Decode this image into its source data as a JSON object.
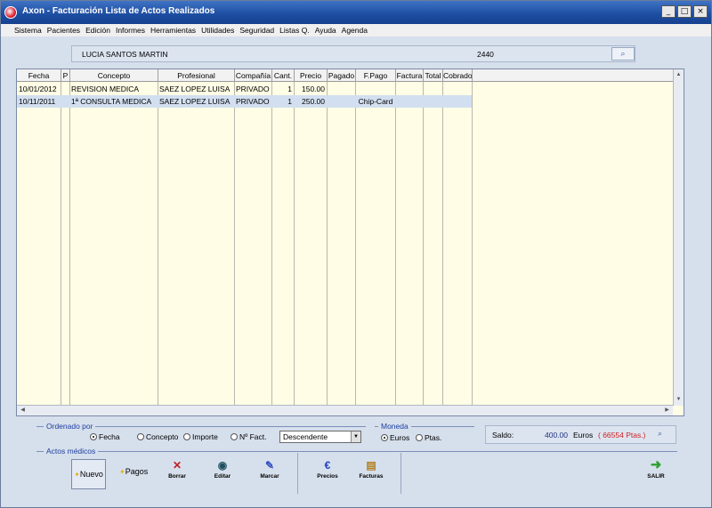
{
  "window": {
    "title": "Axon - Facturación Lista de Actos Realizados"
  },
  "window_buttons": {
    "minimize": "_",
    "maximize": "□",
    "close": "×"
  },
  "menu": [
    "Sistema",
    "Pacientes",
    "Edición",
    "Informes",
    "Herramientas",
    "Utilidades",
    "Seguridad",
    "Listas Q.",
    "Ayuda",
    "Agenda"
  ],
  "patient": {
    "name": "LUCIA SANTOS MARTIN",
    "id": "2440",
    "search_icon": "magnifier-icon"
  },
  "grid": {
    "columns": [
      "Fecha",
      "P",
      "Concepto",
      "Profesional",
      "Compañía",
      "Cant.",
      "Precio",
      "Pagado",
      "F.Pago",
      "Factura",
      "Total",
      "Cobrado"
    ],
    "rows": [
      {
        "fecha": "10/01/2012",
        "p": "",
        "concepto": "REVISION MEDICA",
        "profesional": "SAEZ LOPEZ LUISA",
        "compania": "PRIVADO",
        "cant": "1",
        "precio": "150.00",
        "pagado": "",
        "fpago": "",
        "factura": "",
        "total": "",
        "cobrado": "",
        "selected": false
      },
      {
        "fecha": "10/11/2011",
        "p": "",
        "concepto": "1ª CONSULTA MEDICA",
        "profesional": "SAEZ LOPEZ LUISA",
        "compania": "PRIVADO",
        "cant": "1",
        "precio": "250.00",
        "pagado": "",
        "fpago": "Chip-Card",
        "factura": "",
        "total": "",
        "cobrado": "",
        "selected": true
      }
    ]
  },
  "ordenado_por": {
    "label": "Ordenado por",
    "options": [
      {
        "label": "Fecha",
        "selected": true
      },
      {
        "label": "Concepto",
        "selected": false
      },
      {
        "label": "Importe",
        "selected": false
      },
      {
        "label": "Nº Fact.",
        "selected": false
      }
    ],
    "order": "Descendente"
  },
  "moneda": {
    "label": "Moneda",
    "options": [
      {
        "label": "Euros",
        "selected": true
      },
      {
        "label": "Ptas.",
        "selected": false
      }
    ]
  },
  "saldo": {
    "label": "Saldo:",
    "value": "400.00",
    "currency": "Euros",
    "ptas": "( 66554 Ptas.)"
  },
  "actos_medicos": {
    "label": "Actos médicos"
  },
  "toolbar": {
    "nuevo": "Nuevo",
    "pagos": "Pagos",
    "borrar": "Borrar",
    "editar": "Editar",
    "marcar": "Marcar",
    "precios": "Precios",
    "facturas": "Facturas",
    "salir": "SALIR"
  },
  "colors": {
    "grid_bg": "#fffde5",
    "selected_row": "#d2dff0",
    "title_bar": "#1e4fa3",
    "legend_text": "#2040a0",
    "ptas_text": "#d02020"
  }
}
